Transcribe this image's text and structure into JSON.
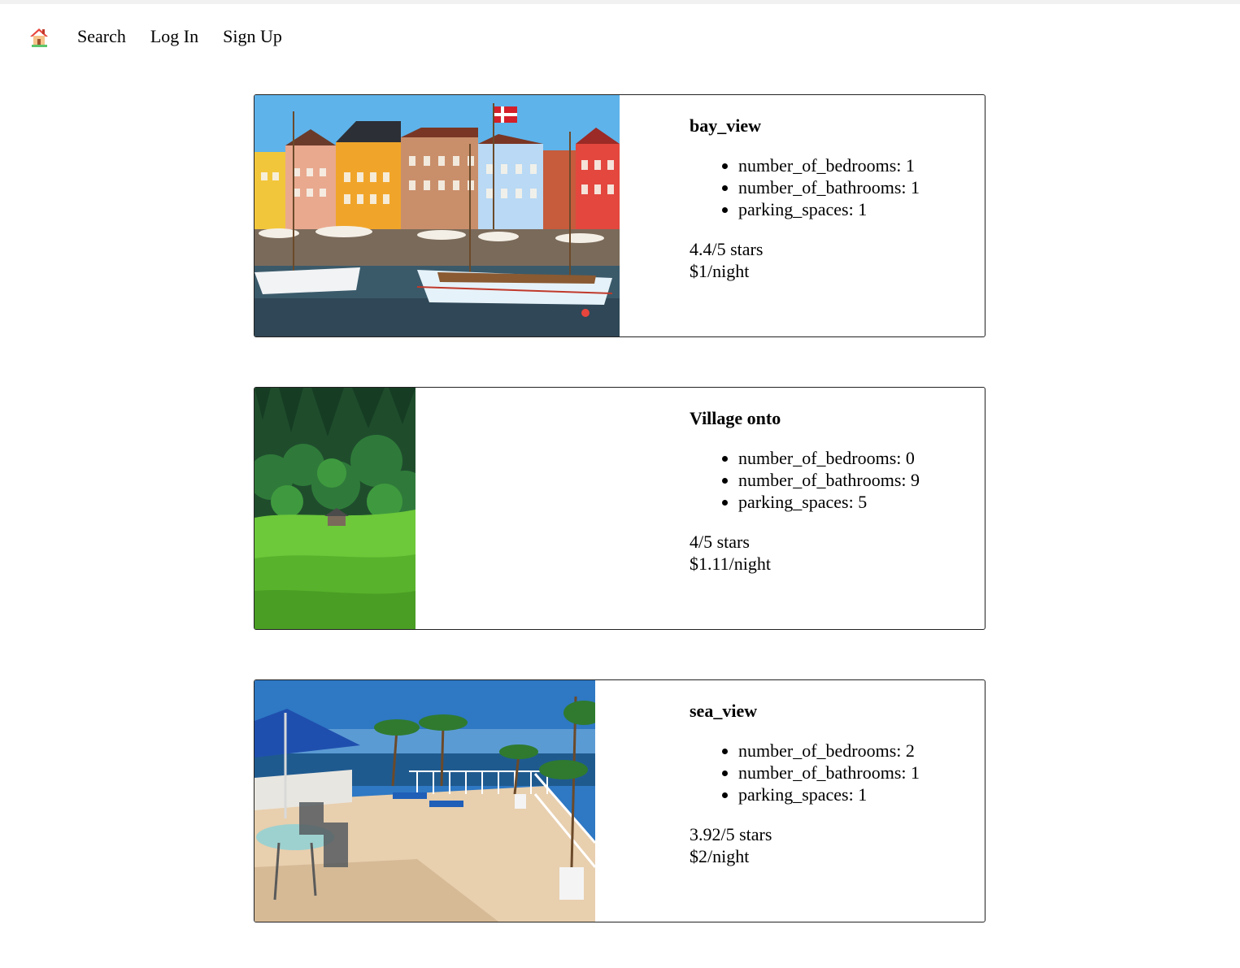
{
  "nav": {
    "home_icon": "house-icon",
    "links": [
      "Search",
      "Log In",
      "Sign Up"
    ]
  },
  "listings": [
    {
      "title": "bay_view",
      "features": [
        "number_of_bedrooms: 1",
        "number_of_bathrooms: 1",
        "parking_spaces: 1"
      ],
      "rating": "4.4/5 stars",
      "price": "$1/night"
    },
    {
      "title": "Village onto",
      "features": [
        "number_of_bedrooms: 0",
        "number_of_bathrooms: 9",
        "parking_spaces: 5"
      ],
      "rating": "4/5 stars",
      "price": "$1.11/night"
    },
    {
      "title": "sea_view",
      "features": [
        "number_of_bedrooms: 2",
        "number_of_bathrooms: 1",
        "parking_spaces: 1"
      ],
      "rating": "3.92/5 stars",
      "price": "$2/night"
    }
  ],
  "colors": {
    "border": "#222222",
    "text": "#000000"
  }
}
